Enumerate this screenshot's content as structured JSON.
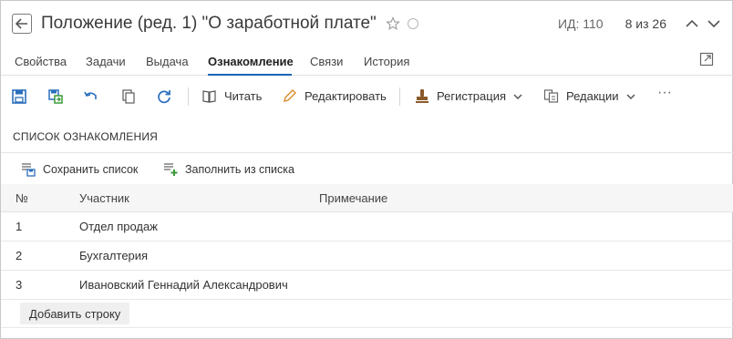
{
  "header": {
    "title": "Положение (ред. 1) \"О заработной плате\"",
    "id_label": "ИД: 110",
    "pager": "8 из 26",
    "icons": [
      "back-arrow-icon",
      "star-icon",
      "status-circle-icon",
      "chevron-up-icon",
      "chevron-down-icon"
    ]
  },
  "tabs": [
    {
      "label": "Свойства",
      "active": false
    },
    {
      "label": "Задачи",
      "active": false
    },
    {
      "label": "Выдача",
      "active": false
    },
    {
      "label": "Ознакомление",
      "active": true
    },
    {
      "label": "Связи",
      "active": false
    },
    {
      "label": "История",
      "active": false
    }
  ],
  "toolbar": {
    "read": "Читать",
    "edit": "Редактировать",
    "registration": "Регистрация",
    "revisions": "Редакции",
    "more": "···",
    "icons": [
      "save-icon",
      "save-and-close-icon",
      "undo-icon",
      "copy-icon",
      "refresh-icon",
      "book-icon",
      "pencil-icon",
      "stamp-icon",
      "revisions-icon"
    ]
  },
  "section": {
    "title": "СПИСОК ОЗНАКОМЛЕНИЯ",
    "save_list": "Сохранить список",
    "fill_from_list": "Заполнить из списка"
  },
  "table": {
    "columns": [
      "№",
      "Участник",
      "Примечание"
    ],
    "rows": [
      {
        "num": "1",
        "participant": "Отдел продаж",
        "note": ""
      },
      {
        "num": "2",
        "participant": "Бухгалтерия",
        "note": ""
      },
      {
        "num": "3",
        "participant": "Ивановский Геннадий Александрович",
        "note": ""
      }
    ],
    "add_row": "Добавить строку"
  },
  "colors": {
    "accent": "#1c63b7",
    "icon_blue": "#2a6ebd",
    "icon_green": "#3a9a3a",
    "stamp_brown": "#8a5a2b",
    "pencil_orange": "#d98a2b"
  }
}
